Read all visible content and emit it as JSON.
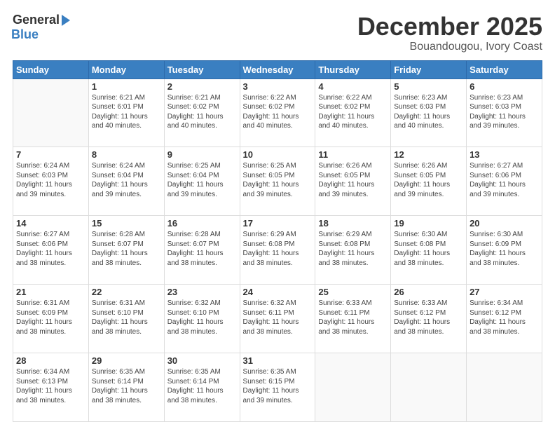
{
  "logo": {
    "general": "General",
    "blue": "Blue"
  },
  "header": {
    "month": "December 2025",
    "location": "Bouandougou, Ivory Coast"
  },
  "days_of_week": [
    "Sunday",
    "Monday",
    "Tuesday",
    "Wednesday",
    "Thursday",
    "Friday",
    "Saturday"
  ],
  "weeks": [
    [
      {
        "day": "",
        "info": ""
      },
      {
        "day": "1",
        "info": "Sunrise: 6:21 AM\nSunset: 6:01 PM\nDaylight: 11 hours\nand 40 minutes."
      },
      {
        "day": "2",
        "info": "Sunrise: 6:21 AM\nSunset: 6:02 PM\nDaylight: 11 hours\nand 40 minutes."
      },
      {
        "day": "3",
        "info": "Sunrise: 6:22 AM\nSunset: 6:02 PM\nDaylight: 11 hours\nand 40 minutes."
      },
      {
        "day": "4",
        "info": "Sunrise: 6:22 AM\nSunset: 6:02 PM\nDaylight: 11 hours\nand 40 minutes."
      },
      {
        "day": "5",
        "info": "Sunrise: 6:23 AM\nSunset: 6:03 PM\nDaylight: 11 hours\nand 40 minutes."
      },
      {
        "day": "6",
        "info": "Sunrise: 6:23 AM\nSunset: 6:03 PM\nDaylight: 11 hours\nand 39 minutes."
      }
    ],
    [
      {
        "day": "7",
        "info": "Sunrise: 6:24 AM\nSunset: 6:03 PM\nDaylight: 11 hours\nand 39 minutes."
      },
      {
        "day": "8",
        "info": "Sunrise: 6:24 AM\nSunset: 6:04 PM\nDaylight: 11 hours\nand 39 minutes."
      },
      {
        "day": "9",
        "info": "Sunrise: 6:25 AM\nSunset: 6:04 PM\nDaylight: 11 hours\nand 39 minutes."
      },
      {
        "day": "10",
        "info": "Sunrise: 6:25 AM\nSunset: 6:05 PM\nDaylight: 11 hours\nand 39 minutes."
      },
      {
        "day": "11",
        "info": "Sunrise: 6:26 AM\nSunset: 6:05 PM\nDaylight: 11 hours\nand 39 minutes."
      },
      {
        "day": "12",
        "info": "Sunrise: 6:26 AM\nSunset: 6:05 PM\nDaylight: 11 hours\nand 39 minutes."
      },
      {
        "day": "13",
        "info": "Sunrise: 6:27 AM\nSunset: 6:06 PM\nDaylight: 11 hours\nand 39 minutes."
      }
    ],
    [
      {
        "day": "14",
        "info": "Sunrise: 6:27 AM\nSunset: 6:06 PM\nDaylight: 11 hours\nand 38 minutes."
      },
      {
        "day": "15",
        "info": "Sunrise: 6:28 AM\nSunset: 6:07 PM\nDaylight: 11 hours\nand 38 minutes."
      },
      {
        "day": "16",
        "info": "Sunrise: 6:28 AM\nSunset: 6:07 PM\nDaylight: 11 hours\nand 38 minutes."
      },
      {
        "day": "17",
        "info": "Sunrise: 6:29 AM\nSunset: 6:08 PM\nDaylight: 11 hours\nand 38 minutes."
      },
      {
        "day": "18",
        "info": "Sunrise: 6:29 AM\nSunset: 6:08 PM\nDaylight: 11 hours\nand 38 minutes."
      },
      {
        "day": "19",
        "info": "Sunrise: 6:30 AM\nSunset: 6:08 PM\nDaylight: 11 hours\nand 38 minutes."
      },
      {
        "day": "20",
        "info": "Sunrise: 6:30 AM\nSunset: 6:09 PM\nDaylight: 11 hours\nand 38 minutes."
      }
    ],
    [
      {
        "day": "21",
        "info": "Sunrise: 6:31 AM\nSunset: 6:09 PM\nDaylight: 11 hours\nand 38 minutes."
      },
      {
        "day": "22",
        "info": "Sunrise: 6:31 AM\nSunset: 6:10 PM\nDaylight: 11 hours\nand 38 minutes."
      },
      {
        "day": "23",
        "info": "Sunrise: 6:32 AM\nSunset: 6:10 PM\nDaylight: 11 hours\nand 38 minutes."
      },
      {
        "day": "24",
        "info": "Sunrise: 6:32 AM\nSunset: 6:11 PM\nDaylight: 11 hours\nand 38 minutes."
      },
      {
        "day": "25",
        "info": "Sunrise: 6:33 AM\nSunset: 6:11 PM\nDaylight: 11 hours\nand 38 minutes."
      },
      {
        "day": "26",
        "info": "Sunrise: 6:33 AM\nSunset: 6:12 PM\nDaylight: 11 hours\nand 38 minutes."
      },
      {
        "day": "27",
        "info": "Sunrise: 6:34 AM\nSunset: 6:12 PM\nDaylight: 11 hours\nand 38 minutes."
      }
    ],
    [
      {
        "day": "28",
        "info": "Sunrise: 6:34 AM\nSunset: 6:13 PM\nDaylight: 11 hours\nand 38 minutes."
      },
      {
        "day": "29",
        "info": "Sunrise: 6:35 AM\nSunset: 6:14 PM\nDaylight: 11 hours\nand 38 minutes."
      },
      {
        "day": "30",
        "info": "Sunrise: 6:35 AM\nSunset: 6:14 PM\nDaylight: 11 hours\nand 38 minutes."
      },
      {
        "day": "31",
        "info": "Sunrise: 6:35 AM\nSunset: 6:15 PM\nDaylight: 11 hours\nand 39 minutes."
      },
      {
        "day": "",
        "info": ""
      },
      {
        "day": "",
        "info": ""
      },
      {
        "day": "",
        "info": ""
      }
    ]
  ]
}
